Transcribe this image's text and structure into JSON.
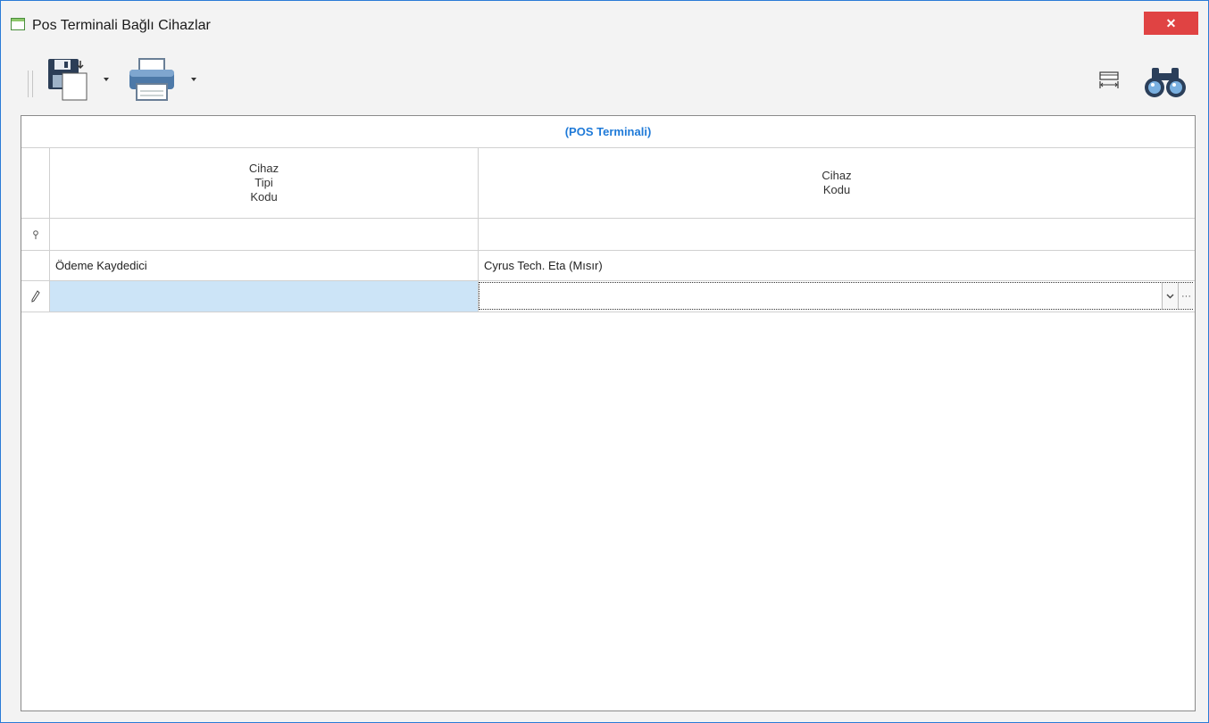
{
  "window": {
    "title": "Pos Terminali Bağlı Cihazlar",
    "close_label": "✕"
  },
  "toolbar": {
    "save_icon": "save-floppy-icon",
    "print_icon": "printer-icon",
    "column_width_icon": "column-width-icon",
    "find_icon": "binoculars-icon"
  },
  "grid": {
    "band_title": "(POS Terminali)",
    "columns": [
      {
        "header": "Cihaz\nTipi\nKodu"
      },
      {
        "header": "Cihaz\nKodu"
      }
    ],
    "filter_row": [
      "",
      ""
    ],
    "rows": [
      [
        "Ödeme Kaydedici",
        "Cyrus Tech. Eta (Mısır)"
      ]
    ],
    "new_row": [
      "",
      ""
    ]
  },
  "colors": {
    "accent": "#1f7ad8",
    "close": "#e04343",
    "selection": "#cce4f7",
    "border": "#2b7bd6"
  }
}
